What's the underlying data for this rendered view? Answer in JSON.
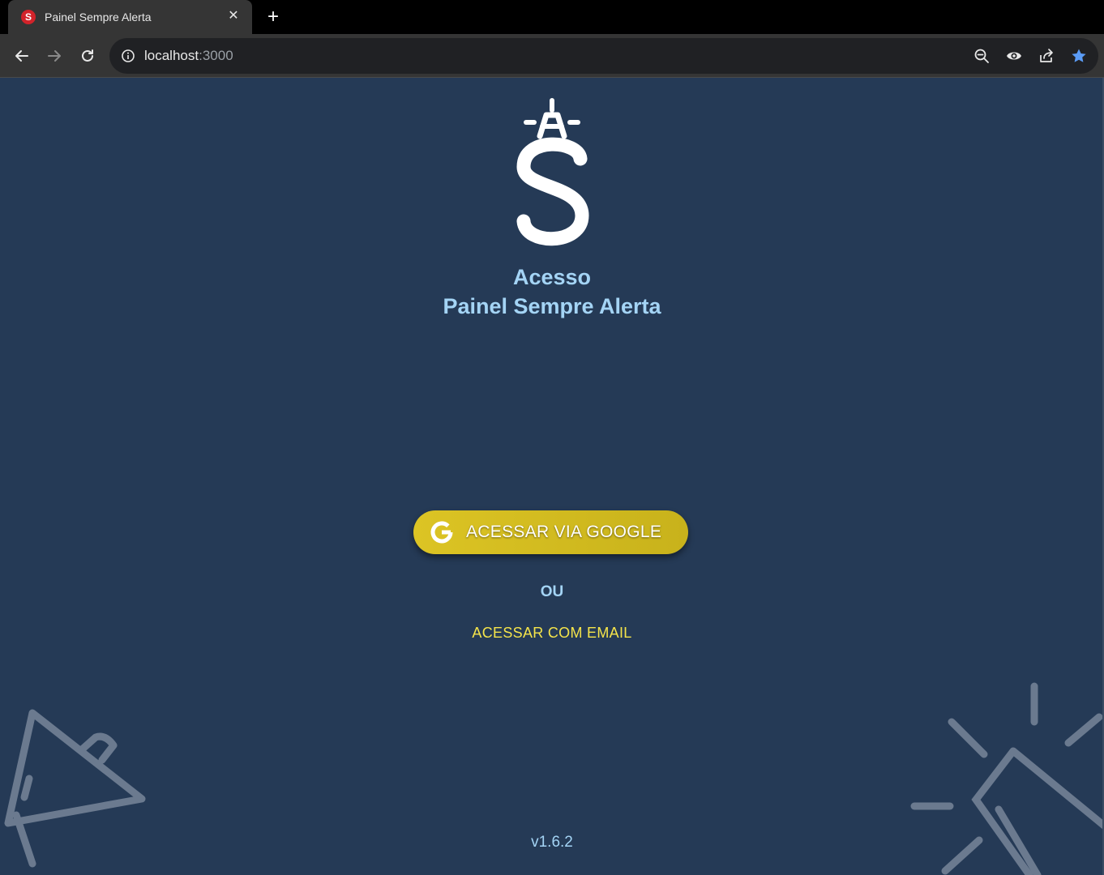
{
  "browser": {
    "tab_title": "Painel Sempre Alerta",
    "favicon_letter": "S",
    "url_host": "localhost",
    "url_port": ":3000"
  },
  "page": {
    "logo_alt": "Sempre Alerta logo",
    "heading_line1": "Acesso",
    "heading_line2": "Painel Sempre Alerta",
    "google_button_label": "ACESSAR VIA GOOGLE",
    "separator": "OU",
    "email_link_label": "ACESSAR COM EMAIL",
    "version": "v1.6.2"
  },
  "colors": {
    "background": "#253a56",
    "heading": "#a4d4f5",
    "button": "#d4bd20",
    "link": "#f5e44a"
  }
}
